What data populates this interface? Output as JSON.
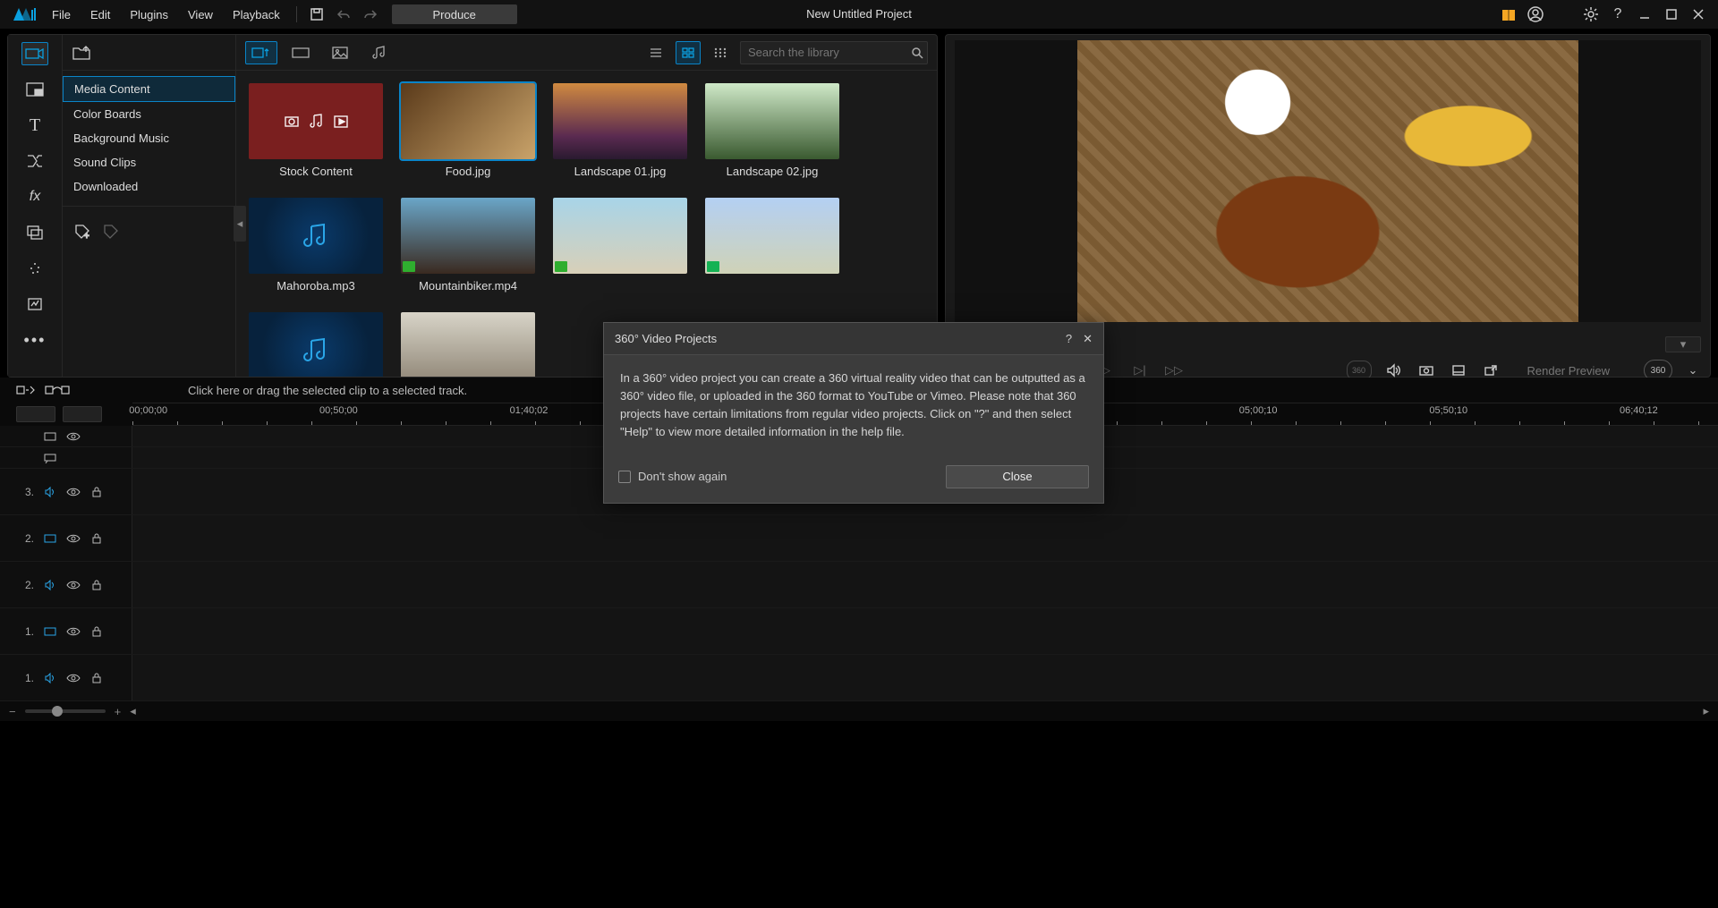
{
  "menu": {
    "file": "File",
    "edit": "Edit",
    "plugins": "Plugins",
    "view": "View",
    "playback": "Playback",
    "produce": "Produce"
  },
  "project_title": "New Untitled Project",
  "sidebar": {
    "items": [
      {
        "label": "Media Content"
      },
      {
        "label": "Color Boards"
      },
      {
        "label": "Background Music"
      },
      {
        "label": "Sound Clips"
      },
      {
        "label": "Downloaded"
      }
    ]
  },
  "search": {
    "placeholder": "Search the library"
  },
  "media": {
    "items": [
      {
        "label": "Stock Content"
      },
      {
        "label": "Food.jpg"
      },
      {
        "label": "Landscape 01.jpg"
      },
      {
        "label": "Landscape 02.jpg"
      },
      {
        "label": "Mahoroba.mp3"
      },
      {
        "label": "Mountainbiker.mp4"
      },
      {
        "label": ""
      },
      {
        "label": ""
      }
    ]
  },
  "timeline": {
    "hint": "Click here or drag the selected clip to a selected track.",
    "ticks": [
      "00;00;00",
      "00;50;00",
      "01;40;02",
      "",
      "",
      "",
      "05;00;10",
      "05;50;10",
      "06;40;12"
    ],
    "tracks": [
      {
        "num": "",
        "kind": "video"
      },
      {
        "num": "",
        "kind": "note"
      },
      {
        "num": "3.",
        "kind": "audio"
      },
      {
        "num": "2.",
        "kind": "video"
      },
      {
        "num": "2.",
        "kind": "audio"
      },
      {
        "num": "1.",
        "kind": "video"
      },
      {
        "num": "1.",
        "kind": "audio"
      }
    ]
  },
  "preview": {
    "render_label": "Render Preview",
    "badge": "360"
  },
  "dialog": {
    "title": "360° Video Projects",
    "body": "In a 360° video project you can create a 360 virtual reality video that can be outputted as a 360° video file, or uploaded in the 360 format to YouTube or Vimeo. Please note that 360 projects have certain limitations from regular video projects. Click on \"?\" and then select \"Help\" to view more detailed information in the help file.",
    "dont_show": "Don't show again",
    "close": "Close"
  }
}
